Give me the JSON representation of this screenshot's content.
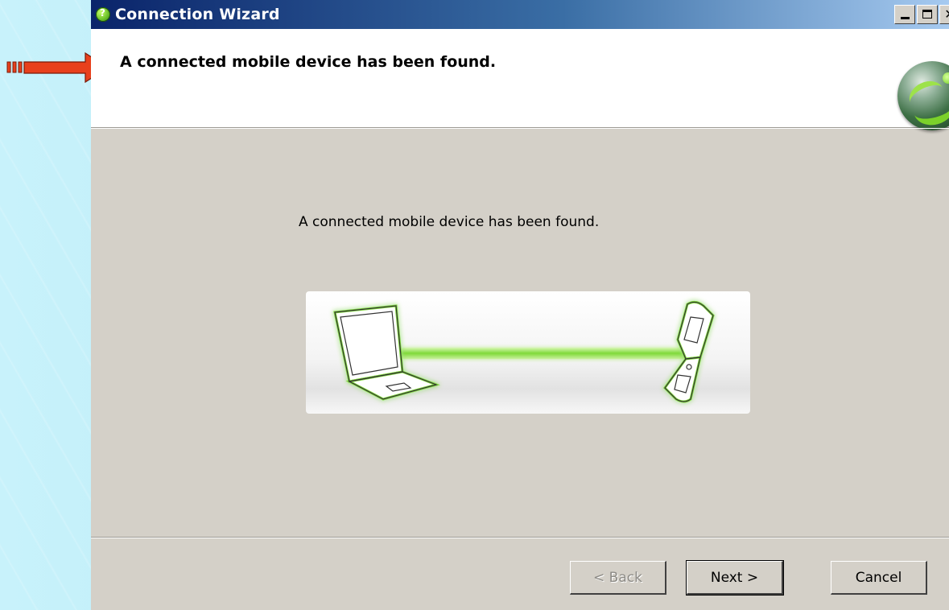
{
  "window": {
    "title": "Connection Wizard",
    "controls": [
      "minimize",
      "maximize",
      "close"
    ]
  },
  "header": {
    "title": "A connected mobile device has been found.",
    "logo_icon": "sony-ericsson-logo-icon"
  },
  "content": {
    "message": "A connected mobile device has been found.",
    "illustration": "laptop-connected-to-phone",
    "accent_color": "#7fd93a"
  },
  "buttons": {
    "back_label": "< Back",
    "next_label": "Next >",
    "cancel_label": "Cancel"
  },
  "annotation": {
    "arrow_color": "#e8401c"
  }
}
